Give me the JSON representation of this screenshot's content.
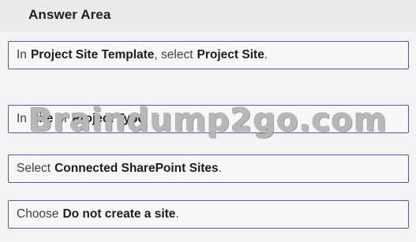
{
  "title": "Answer Area",
  "actions": [
    {
      "a": "In",
      "b": "Project Site Template",
      "c": ", select",
      "d": "Project Site",
      "e": "."
    },
    {
      "a": "In",
      "b": "Site",
      "c": "or",
      "d": "Project Type",
      "e": ""
    },
    {
      "a": "Select",
      "b": "Connected SharePoint Sites",
      "c": ".",
      "d": "",
      "e": ""
    },
    {
      "a": "Choose",
      "b": "Do not create a site",
      "c": ".",
      "d": "",
      "e": ""
    }
  ],
  "watermark": "Braindump2go.com"
}
